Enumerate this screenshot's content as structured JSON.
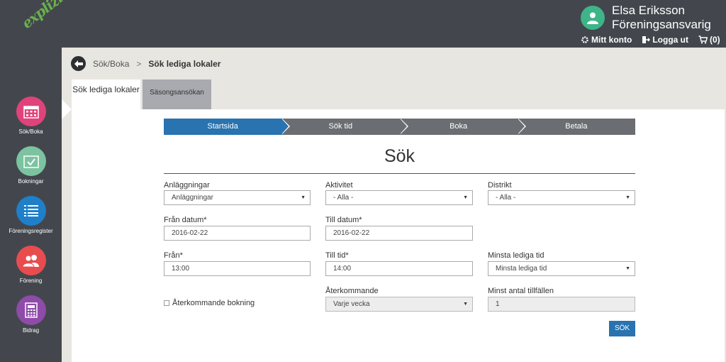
{
  "header": {
    "logo_text": "explizit",
    "user_name": "Elsa Eriksson",
    "user_role": "Föreningsansvarig",
    "links": [
      {
        "icon": "gear-icon",
        "label": "Mitt konto"
      },
      {
        "icon": "logout-icon",
        "label": "Logga ut"
      },
      {
        "icon": "cart-icon",
        "label": "(0)"
      }
    ]
  },
  "sidebar": {
    "items": [
      {
        "label": "Sök/Boka",
        "icon": "calendar-icon",
        "color": "#e0427a"
      },
      {
        "label": "Bokningar",
        "icon": "calendar-check-icon",
        "color": "#7cc3a0"
      },
      {
        "label": "Föreningsregister",
        "icon": "list-icon",
        "color": "#1f7fc9"
      },
      {
        "label": "Förening",
        "icon": "group-icon",
        "color": "#e84c4f"
      },
      {
        "label": "Bidrag",
        "icon": "calculator-icon",
        "color": "#8e4ba8"
      }
    ]
  },
  "breadcrumb": {
    "parent": "Sök/Boka",
    "separator": ">",
    "current": "Sök lediga lokaler"
  },
  "tabs": {
    "active": "Sök lediga lokaler",
    "inactive": "Säsongsansökan"
  },
  "steps": [
    "Startsida",
    "Sök tid",
    "Boka",
    "Betala"
  ],
  "title": "Sök",
  "form": {
    "anlaggningar": {
      "label": "Anläggningar",
      "value": "Anläggningar"
    },
    "aktivitet": {
      "label": "Aktivitet",
      "value": "- Alla -"
    },
    "distrikt": {
      "label": "Distrikt",
      "value": "- Alla -"
    },
    "fran_datum": {
      "label": "Från datum*",
      "value": "2016-02-22"
    },
    "till_datum": {
      "label": "Till datum*",
      "value": "2016-02-22"
    },
    "fran": {
      "label": "Från*",
      "value": "13:00"
    },
    "till_tid": {
      "label": "Till tid*",
      "value": "14:00"
    },
    "minsta_lediga_tid": {
      "label": "Minsta lediga tid",
      "value": "Minsta lediga tid"
    },
    "aterkommande_checkbox": {
      "label": "Återkommande bokning"
    },
    "aterkommande": {
      "label": "Återkommande",
      "value": "Varje vecka"
    },
    "minst_antal": {
      "label": "Minst antal tillfällen",
      "value": "1"
    },
    "search_button": "SÖK"
  },
  "colors": {
    "topbar": "#43474d",
    "accent_blue": "#2873b0",
    "step_gray": "#6a6d72",
    "avatar_green": "#3eb489"
  }
}
